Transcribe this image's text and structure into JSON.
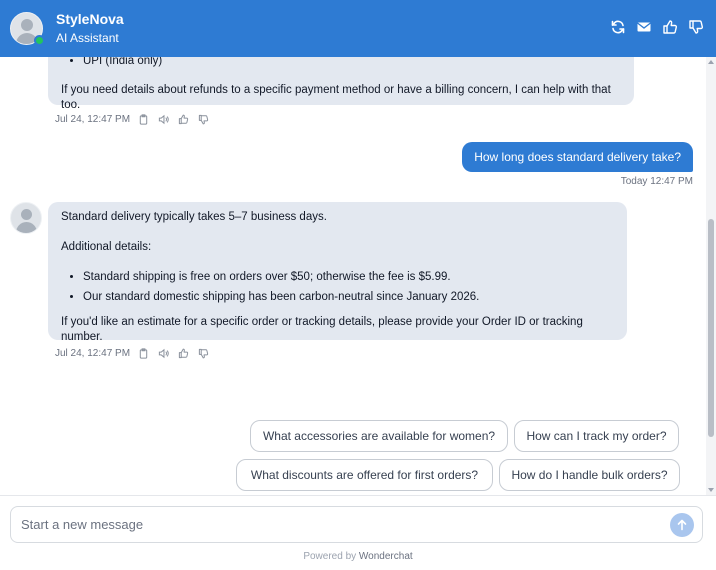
{
  "header": {
    "brand": "StyleNova",
    "subtitle": "AI Assistant",
    "actions": [
      "refresh-icon",
      "mail-icon",
      "thumbs-up-icon",
      "thumbs-down-icon"
    ]
  },
  "messages": {
    "bot1": {
      "bullet": "UPI (India only)",
      "text": "If you need details about refunds to a specific payment method or have a billing concern, I can help with that too.",
      "time": "Jul 24, 12:47 PM"
    },
    "user1": {
      "text": "How long does standard delivery take?",
      "time": "Today 12:47 PM"
    },
    "bot2": {
      "p1": "Standard delivery typically takes 5–7 business days.",
      "p2": "Additional details:",
      "bullets": [
        "Standard shipping is free on orders over $50; otherwise the fee is $5.99.",
        "Our standard domestic shipping has been carbon-neutral since January 2026."
      ],
      "p3": "If you'd like an estimate for a specific order or tracking details, please provide your Order ID or tracking number.",
      "time": "Jul 24, 12:47 PM"
    }
  },
  "suggestions": [
    "What accessories are available for women?",
    "How can I track my order?",
    "What discounts are offered for first orders?",
    "How do I handle bulk orders?"
  ],
  "composer": {
    "placeholder": "Start a new message",
    "value": ""
  },
  "footer": {
    "prefix": "Powered by",
    "brand": "Wonderchat"
  },
  "colors": {
    "accent": "#2e7bd3",
    "bot_bubble": "#e3e8f0",
    "online": "#22c55e"
  }
}
